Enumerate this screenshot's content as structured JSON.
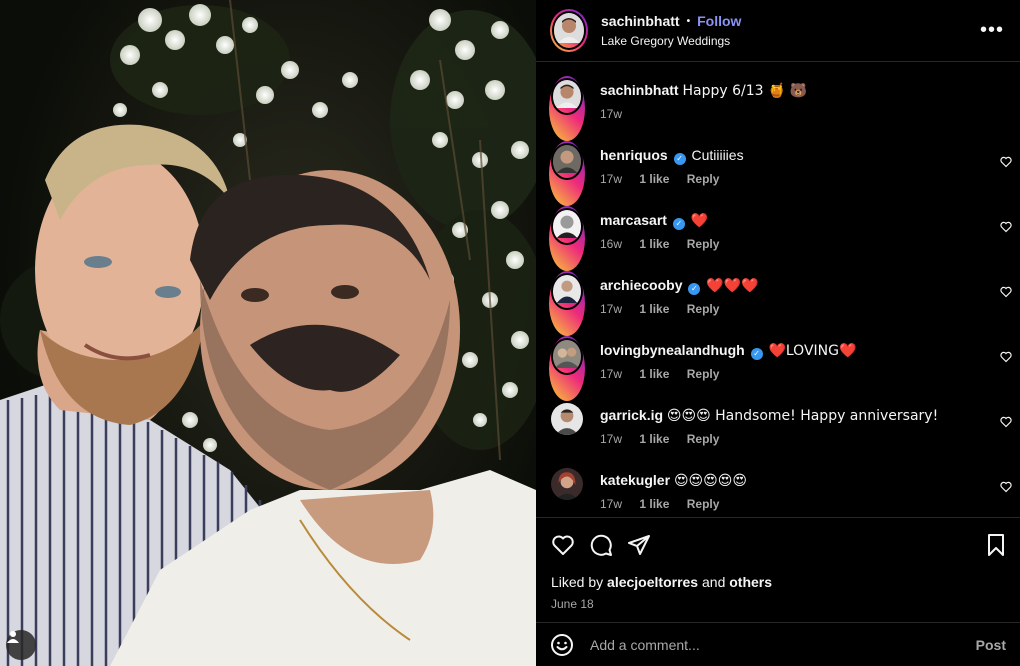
{
  "post": {
    "author": "sachinbhatt",
    "follow_label": "Follow",
    "dot": "•",
    "location": "Lake Gregory Weddings",
    "more_label": "•••"
  },
  "caption": {
    "user": "sachinbhatt",
    "text": "Happy 6/13 🍯 🐻",
    "time": "17w"
  },
  "comments": [
    {
      "user": "henriquos",
      "verified": true,
      "text": "Cutiiiiies",
      "time": "17w",
      "likes": "1 like",
      "reply": "Reply"
    },
    {
      "user": "marcasart",
      "verified": true,
      "text": "❤️",
      "time": "16w",
      "likes": "1 like",
      "reply": "Reply"
    },
    {
      "user": "archiecooby",
      "verified": true,
      "text": "❤️❤️❤️",
      "time": "17w",
      "likes": "1 like",
      "reply": "Reply"
    },
    {
      "user": "lovingbynealandhugh",
      "verified": true,
      "text": "❤️LOVING❤️",
      "time": "17w",
      "likes": "1 like",
      "reply": "Reply"
    },
    {
      "user": "garrick.ig",
      "verified": false,
      "text": "😍😍😍 Handsome! Happy anniversary!",
      "time": "17w",
      "likes": "1 like",
      "reply": "Reply"
    },
    {
      "user": "katekugler",
      "verified": false,
      "text": "😍😍😍😍😍",
      "time": "17w",
      "likes": "1 like",
      "reply": "Reply"
    }
  ],
  "likes": {
    "prefix": "Liked by",
    "user": "alecjoeltorres",
    "and": "and",
    "others": "others"
  },
  "date": "June 18",
  "add_comment": {
    "placeholder": "Add a comment...",
    "post_label": "Post"
  },
  "colors": {
    "follow": "#8b93f5",
    "verified": "#3897f0",
    "muted": "#a8a8a8"
  }
}
